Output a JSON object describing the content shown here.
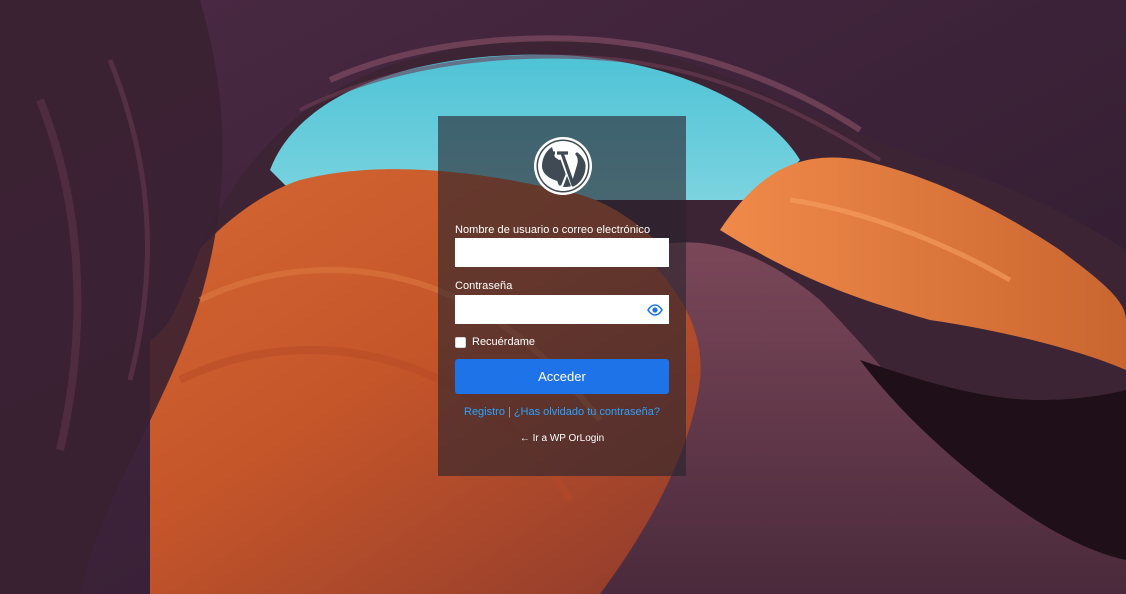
{
  "login": {
    "logo_icon": "wordpress-logo-icon",
    "username_label": "Nombre de usuario o correo electrónico",
    "username_value": "",
    "password_label": "Contraseña",
    "password_value": "",
    "show_password_icon": "eye-icon",
    "remember_label": "Recuérdame",
    "remember_checked": false,
    "submit_label": "Acceder",
    "register_link": "Registro",
    "separator": "|",
    "lost_password_link": "¿Has olvidado tu contraseña?",
    "back_link": "← Ir a WP OrLogin"
  },
  "colors": {
    "panel_overlay": "rgba(40,35,45,0.62)",
    "button": "#1e73e8",
    "link": "#29a3ff"
  }
}
